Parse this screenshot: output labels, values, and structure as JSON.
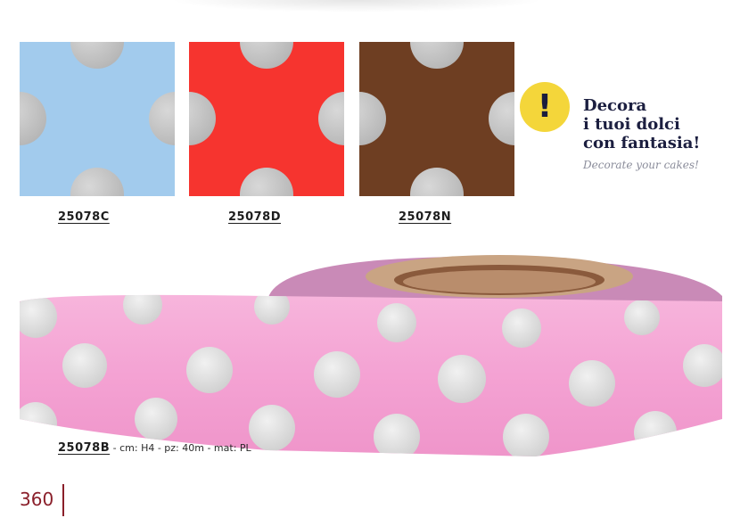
{
  "swatches": [
    {
      "code": "25078C",
      "color": "#a2cbed"
    },
    {
      "code": "25078D",
      "color": "#f6342f"
    },
    {
      "code": "25078N",
      "color": "#6e3e22"
    }
  ],
  "callout": {
    "icon": "exclamation-icon",
    "icon_glyph": "!",
    "title_lines": [
      "Decora",
      "i tuoi dolci",
      "con fantasia!"
    ],
    "subtitle": "Decorate your cakes!",
    "badge_color": "#f4d63a"
  },
  "product": {
    "code": "25078B",
    "specs": " - cm: H4 - pz: 40m - mat: PL",
    "tape_color": "#f4a2d3",
    "dot_color": "#d9d9d9"
  },
  "page": {
    "number": "360",
    "accent_color": "#8a1f2a"
  }
}
